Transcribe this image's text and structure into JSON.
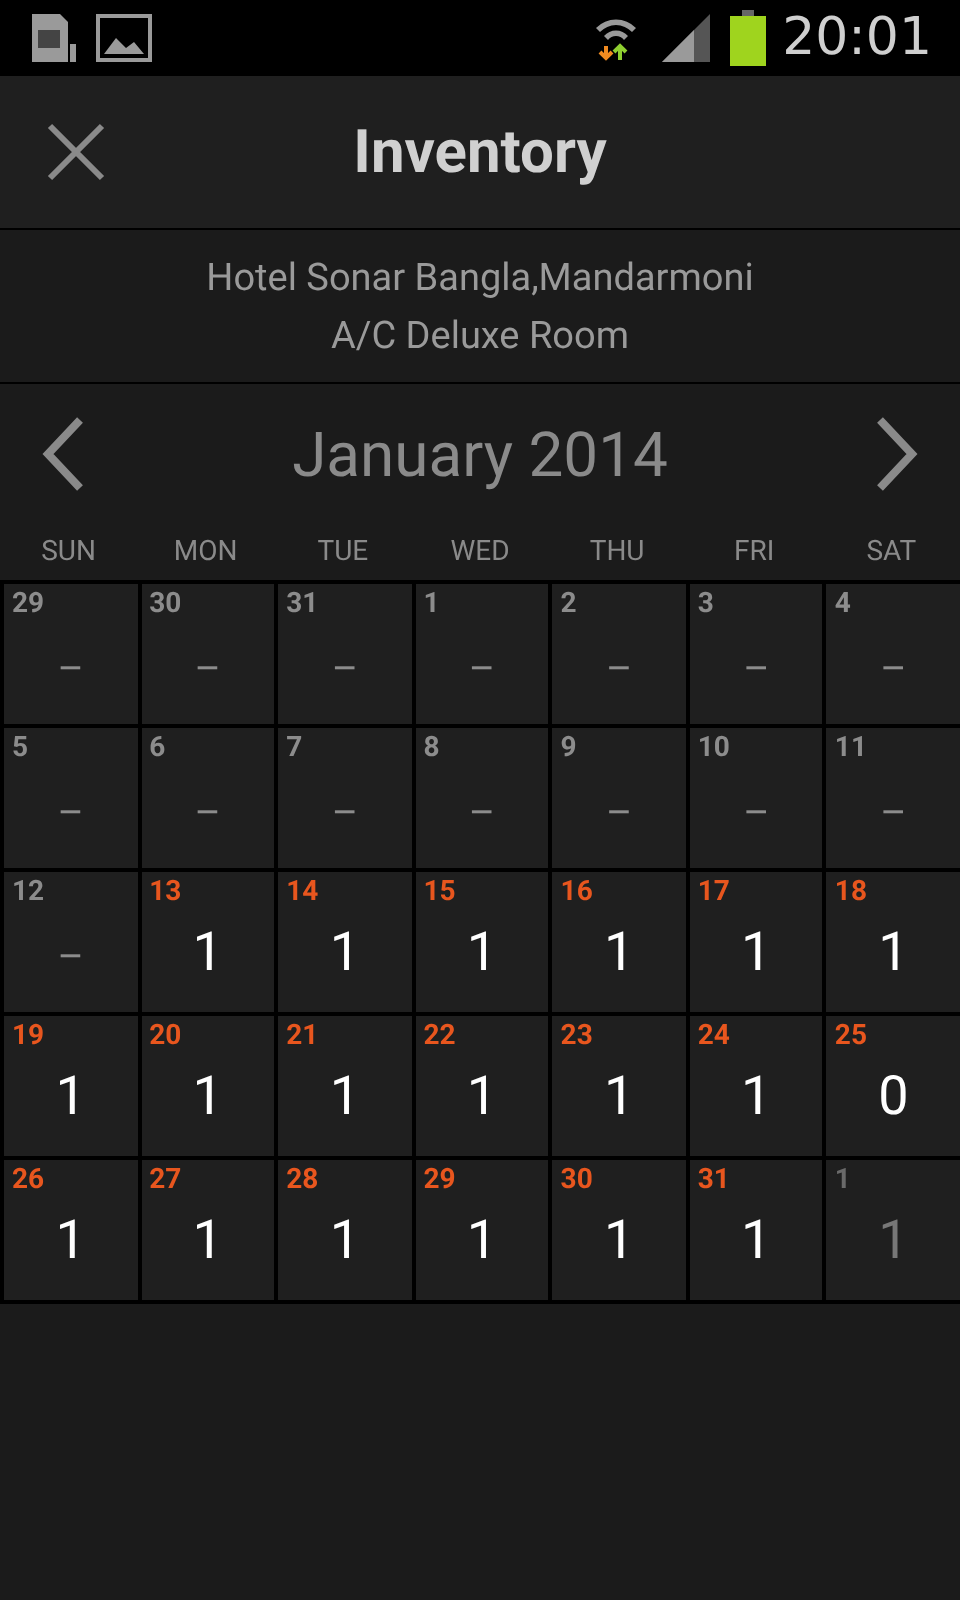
{
  "status_bar": {
    "time": "20:01"
  },
  "header": {
    "title": "Inventory"
  },
  "property": {
    "hotel": "Hotel Sonar Bangla,Mandarmoni",
    "room": "A/C Deluxe Room"
  },
  "calendar": {
    "month": "January 2014",
    "weekdays": [
      "SUN",
      "MON",
      "TUE",
      "WED",
      "THU",
      "FRI",
      "SAT"
    ],
    "days": [
      {
        "day": "29",
        "value": "–",
        "kind": "past"
      },
      {
        "day": "30",
        "value": "–",
        "kind": "past"
      },
      {
        "day": "31",
        "value": "–",
        "kind": "past"
      },
      {
        "day": "1",
        "value": "–",
        "kind": "past"
      },
      {
        "day": "2",
        "value": "–",
        "kind": "past"
      },
      {
        "day": "3",
        "value": "–",
        "kind": "past"
      },
      {
        "day": "4",
        "value": "–",
        "kind": "past"
      },
      {
        "day": "5",
        "value": "–",
        "kind": "past"
      },
      {
        "day": "6",
        "value": "–",
        "kind": "past"
      },
      {
        "day": "7",
        "value": "–",
        "kind": "past"
      },
      {
        "day": "8",
        "value": "–",
        "kind": "past"
      },
      {
        "day": "9",
        "value": "–",
        "kind": "past"
      },
      {
        "day": "10",
        "value": "–",
        "kind": "past"
      },
      {
        "day": "11",
        "value": "–",
        "kind": "past"
      },
      {
        "day": "12",
        "value": "–",
        "kind": "past"
      },
      {
        "day": "13",
        "value": "1",
        "kind": "open"
      },
      {
        "day": "14",
        "value": "1",
        "kind": "open"
      },
      {
        "day": "15",
        "value": "1",
        "kind": "open"
      },
      {
        "day": "16",
        "value": "1",
        "kind": "open"
      },
      {
        "day": "17",
        "value": "1",
        "kind": "open"
      },
      {
        "day": "18",
        "value": "1",
        "kind": "open"
      },
      {
        "day": "19",
        "value": "1",
        "kind": "open"
      },
      {
        "day": "20",
        "value": "1",
        "kind": "open"
      },
      {
        "day": "21",
        "value": "1",
        "kind": "open"
      },
      {
        "day": "22",
        "value": "1",
        "kind": "open"
      },
      {
        "day": "23",
        "value": "1",
        "kind": "open"
      },
      {
        "day": "24",
        "value": "1",
        "kind": "open"
      },
      {
        "day": "25",
        "value": "0",
        "kind": "open"
      },
      {
        "day": "26",
        "value": "1",
        "kind": "open"
      },
      {
        "day": "27",
        "value": "1",
        "kind": "open"
      },
      {
        "day": "28",
        "value": "1",
        "kind": "open"
      },
      {
        "day": "29",
        "value": "1",
        "kind": "open"
      },
      {
        "day": "30",
        "value": "1",
        "kind": "open"
      },
      {
        "day": "31",
        "value": "1",
        "kind": "open"
      },
      {
        "day": "1",
        "value": "1",
        "kind": "overflow"
      }
    ]
  }
}
